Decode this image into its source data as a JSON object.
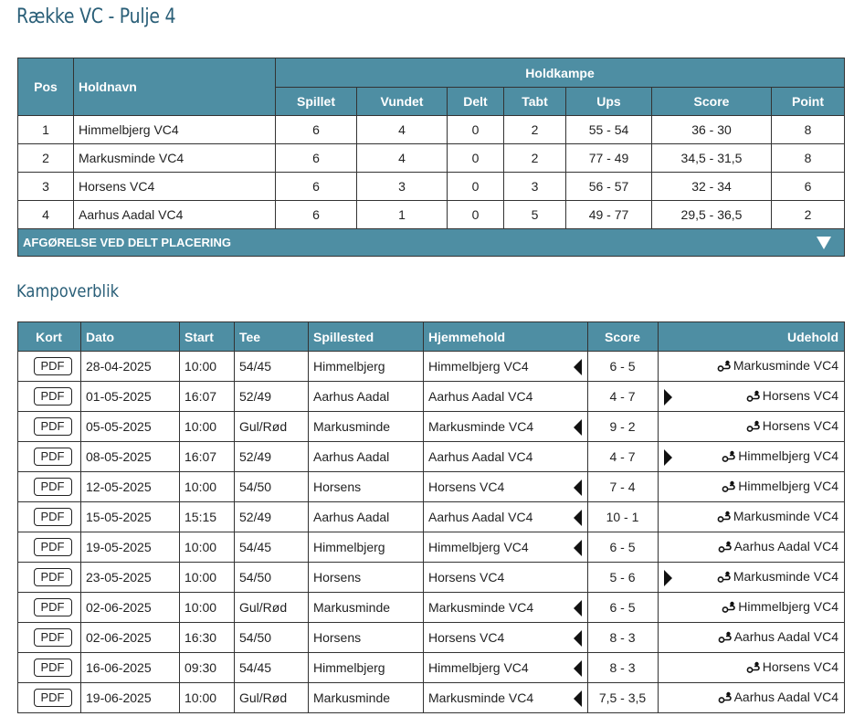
{
  "page": {
    "title": "Række VC - Pulje 4",
    "section_title": "Kampoverblik"
  },
  "standings": {
    "headers": {
      "pos": "Pos",
      "team": "Holdnavn",
      "group": "Holdkampe",
      "played": "Spillet",
      "won": "Vundet",
      "drawn": "Delt",
      "lost": "Tabt",
      "ups": "Ups",
      "score": "Score",
      "points": "Point"
    },
    "rows": [
      {
        "pos": "1",
        "team": "Himmelbjerg VC4",
        "played": "6",
        "won": "4",
        "drawn": "0",
        "lost": "2",
        "ups": "55 - 54",
        "score": "36 - 30",
        "points": "8"
      },
      {
        "pos": "2",
        "team": "Markusminde VC4",
        "played": "6",
        "won": "4",
        "drawn": "0",
        "lost": "2",
        "ups": "77 - 49",
        "score": "34,5 - 31,5",
        "points": "8"
      },
      {
        "pos": "3",
        "team": "Horsens VC4",
        "played": "6",
        "won": "3",
        "drawn": "0",
        "lost": "3",
        "ups": "56 - 57",
        "score": "32 - 34",
        "points": "6"
      },
      {
        "pos": "4",
        "team": "Aarhus Aadal VC4",
        "played": "6",
        "won": "1",
        "drawn": "0",
        "lost": "5",
        "ups": "49 - 77",
        "score": "29,5 - 36,5",
        "points": "2"
      }
    ],
    "footer_label": "AFGØRELSE VED DELT PLACERING"
  },
  "matches": {
    "headers": {
      "card": "Kort",
      "date": "Dato",
      "start": "Start",
      "tee": "Tee",
      "venue": "Spillested",
      "home": "Hjemmehold",
      "score": "Score",
      "away": "Udehold"
    },
    "pdf_label": "PDF",
    "rows": [
      {
        "date": "28-04-2025",
        "start": "10:00",
        "tee": "54/45",
        "venue": "Himmelbjerg",
        "home": "Himmelbjerg VC4",
        "score": "6 - 5",
        "away": "Markusminde VC4",
        "winner": "home"
      },
      {
        "date": "01-05-2025",
        "start": "16:07",
        "tee": "52/49",
        "venue": "Aarhus Aadal",
        "home": "Aarhus Aadal VC4",
        "score": "4 - 7",
        "away": "Horsens VC4",
        "winner": "away"
      },
      {
        "date": "05-05-2025",
        "start": "10:00",
        "tee": "Gul/Rød",
        "venue": "Markusminde",
        "home": "Markusminde VC4",
        "score": "9 - 2",
        "away": "Horsens VC4",
        "winner": "home"
      },
      {
        "date": "08-05-2025",
        "start": "16:07",
        "tee": "52/49",
        "venue": "Aarhus Aadal",
        "home": "Aarhus Aadal VC4",
        "score": "4 - 7",
        "away": "Himmelbjerg VC4",
        "winner": "away"
      },
      {
        "date": "12-05-2025",
        "start": "10:00",
        "tee": "54/50",
        "venue": "Horsens",
        "home": "Horsens VC4",
        "score": "7 - 4",
        "away": "Himmelbjerg VC4",
        "winner": "home"
      },
      {
        "date": "15-05-2025",
        "start": "15:15",
        "tee": "52/49",
        "venue": "Aarhus Aadal",
        "home": "Aarhus Aadal VC4",
        "score": "10 - 1",
        "away": "Markusminde VC4",
        "winner": "home"
      },
      {
        "date": "19-05-2025",
        "start": "10:00",
        "tee": "54/45",
        "venue": "Himmelbjerg",
        "home": "Himmelbjerg VC4",
        "score": "6 - 5",
        "away": "Aarhus Aadal VC4",
        "winner": "home"
      },
      {
        "date": "23-05-2025",
        "start": "10:00",
        "tee": "54/50",
        "venue": "Horsens",
        "home": "Horsens VC4",
        "score": "5 - 6",
        "away": "Markusminde VC4",
        "winner": "away"
      },
      {
        "date": "02-06-2025",
        "start": "10:00",
        "tee": "Gul/Rød",
        "venue": "Markusminde",
        "home": "Markusminde VC4",
        "score": "6 - 5",
        "away": "Himmelbjerg VC4",
        "winner": "home"
      },
      {
        "date": "02-06-2025",
        "start": "16:30",
        "tee": "54/50",
        "venue": "Horsens",
        "home": "Horsens VC4",
        "score": "8 - 3",
        "away": "Aarhus Aadal VC4",
        "winner": "home"
      },
      {
        "date": "16-06-2025",
        "start": "09:30",
        "tee": "54/45",
        "venue": "Himmelbjerg",
        "home": "Himmelbjerg VC4",
        "score": "8 - 3",
        "away": "Horsens VC4",
        "winner": "home"
      },
      {
        "date": "19-06-2025",
        "start": "10:00",
        "tee": "Gul/Rød",
        "venue": "Markusminde",
        "home": "Markusminde VC4",
        "score": "7,5 - 3,5",
        "away": "Aarhus Aadal VC4",
        "winner": "home"
      }
    ]
  },
  "icons": {
    "expand": "triangle-down-icon",
    "winner_home": "triangle-left-icon",
    "winner_away": "triangle-right-icon",
    "away_route": "route-icon"
  },
  "colors": {
    "header_bg": "#4e8ea3",
    "title": "#2a5f78"
  }
}
